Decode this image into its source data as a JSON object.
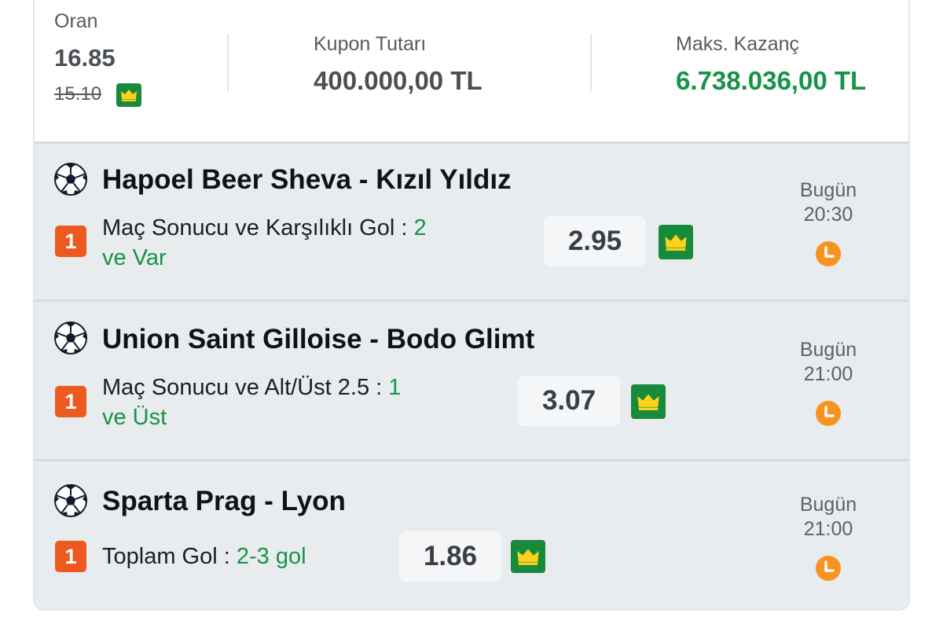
{
  "summary": {
    "oran_label": "Oran",
    "oran_value": "16.85",
    "oran_old": "15.10",
    "kupon_label": "Kupon Tutarı",
    "kupon_value": "400.000,00 TL",
    "maks_label": "Maks. Kazanç",
    "maks_value": "6.738.036,00 TL"
  },
  "bets": [
    {
      "match": "Hapoel Beer Sheva - Kızıl Yıldız",
      "badge": "1",
      "market_line1": "Maç Sonucu ve Karşılıklı Gol : ",
      "selection_line1": "2",
      "selection_line2": "ve Var",
      "odds": "2.95",
      "day": "Bugün",
      "time": "20:30"
    },
    {
      "match": "Union Saint Gilloise - Bodo Glimt",
      "badge": "1",
      "market_line1": "Maç Sonucu ve Alt/Üst 2.5 : ",
      "selection_line1": "1",
      "selection_line2": "ve Üst",
      "odds": "3.07",
      "day": "Bugün",
      "time": "21:00"
    },
    {
      "match": "Sparta Prag - Lyon",
      "badge": "1",
      "market_line1": "Toplam Gol : ",
      "selection_line1": "2-3 gol",
      "odds": "1.86",
      "day": "Bugün",
      "time": "21:00"
    }
  ],
  "icons": {
    "sport": "soccer-ball-icon",
    "boost": "crown-icon",
    "time": "clock-icon"
  },
  "colors": {
    "accent_green": "#159447",
    "crown_bg": "#188a3c",
    "badge_orange": "#ec5a20",
    "clock_orange": "#f7931e"
  }
}
